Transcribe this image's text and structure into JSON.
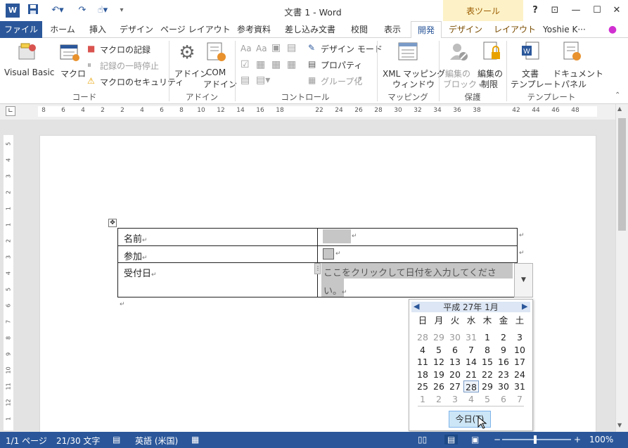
{
  "titlebar": {
    "title": "文書 1 - Word",
    "table_tools": "表ツール",
    "help": "?",
    "restore_ribbon": "⊡",
    "minimize": "—",
    "maximize": "☐",
    "close": "✕"
  },
  "tabs": {
    "file": "ファイル",
    "home": "ホーム",
    "insert": "挿入",
    "design": "デザイン",
    "page_layout": "ページ レイアウト",
    "references": "参考資料",
    "mailings": "差し込み文書",
    "review": "校閲",
    "view": "表示",
    "developer": "開発",
    "tt_design": "デザイン",
    "tt_layout": "レイアウト",
    "user": "Yoshie K···"
  },
  "ribbon": {
    "code": {
      "visual_basic": "Visual Basic",
      "macros": "マクロ",
      "record_macro": "マクロの記録",
      "pause_recording": "記録の一時停止",
      "macro_security": "マクロのセキュリティ",
      "group_label": "コード"
    },
    "addins": {
      "addins": "アドイン",
      "com_addins_1": "COM",
      "com_addins_2": "アドイン",
      "group_label": "アドイン"
    },
    "controls": {
      "design_mode": "デザイン モード",
      "properties": "プロパティ",
      "group": "グループ化",
      "group_label": "コントロール"
    },
    "mapping": {
      "xml_1": "XML マッピング",
      "xml_2": "ウィンドウ",
      "group_label": "マッピング"
    },
    "protect": {
      "block_1": "編集の",
      "block_2": "ブロック",
      "restrict_1": "編集の",
      "restrict_2": "制限",
      "group_label": "保護"
    },
    "templates": {
      "doc_template_1": "文書",
      "doc_template_2": "テンプレート",
      "doc_panel_1": "ドキュメント",
      "doc_panel_2": "パネル",
      "group_label": "テンプレート"
    }
  },
  "ruler": {
    "h_labels": [
      "8",
      "6",
      "4",
      "2",
      "2",
      "4",
      "6",
      "8",
      "10",
      "12",
      "14",
      "16",
      "18",
      "22",
      "24",
      "26",
      "28",
      "30",
      "32",
      "34",
      "36",
      "38",
      "42",
      "44",
      "46",
      "48"
    ],
    "v_labels": [
      "5",
      "4",
      "3",
      "2",
      "1",
      "1",
      "2",
      "3",
      "4",
      "5",
      "6",
      "7",
      "8",
      "9",
      "10",
      "11",
      "12",
      "1",
      "2"
    ]
  },
  "table": {
    "row1_label": "名前",
    "row2_label": "参加",
    "row3_label": "受付日",
    "date_placeholder_1": "ここをクリックして日付を入力してくださ",
    "date_placeholder_2": "い。",
    "pilcrow": "↵"
  },
  "calendar": {
    "month_title": "平成 27年 1月",
    "weekdays": [
      "日",
      "月",
      "火",
      "水",
      "木",
      "金",
      "土"
    ],
    "weeks": [
      [
        "28",
        "29",
        "30",
        "31",
        "1",
        "2",
        "3"
      ],
      [
        "4",
        "5",
        "6",
        "7",
        "8",
        "9",
        "10"
      ],
      [
        "11",
        "12",
        "13",
        "14",
        "15",
        "16",
        "17"
      ],
      [
        "18",
        "19",
        "20",
        "21",
        "22",
        "23",
        "24"
      ],
      [
        "25",
        "26",
        "27",
        "28",
        "29",
        "30",
        "31"
      ],
      [
        "1",
        "2",
        "3",
        "4",
        "5",
        "6",
        "7"
      ]
    ],
    "dimmed_first_row_count": 4,
    "dimmed_last_row": true,
    "selected_day": "28",
    "today_button": "今日(T)"
  },
  "statusbar": {
    "page": "1/1 ページ",
    "words": "21/30 文字",
    "language": "英語 (米国)",
    "zoom": "100%",
    "zoom_minus": "−",
    "zoom_plus": "+"
  },
  "colors": {
    "accent": "#2b579a",
    "table_tools_bg": "#fdf2c7",
    "content_control_gray": "#c6c6c6",
    "calendar_header_bg": "#dce6f4",
    "today_button_bg": "#cde6f7"
  }
}
